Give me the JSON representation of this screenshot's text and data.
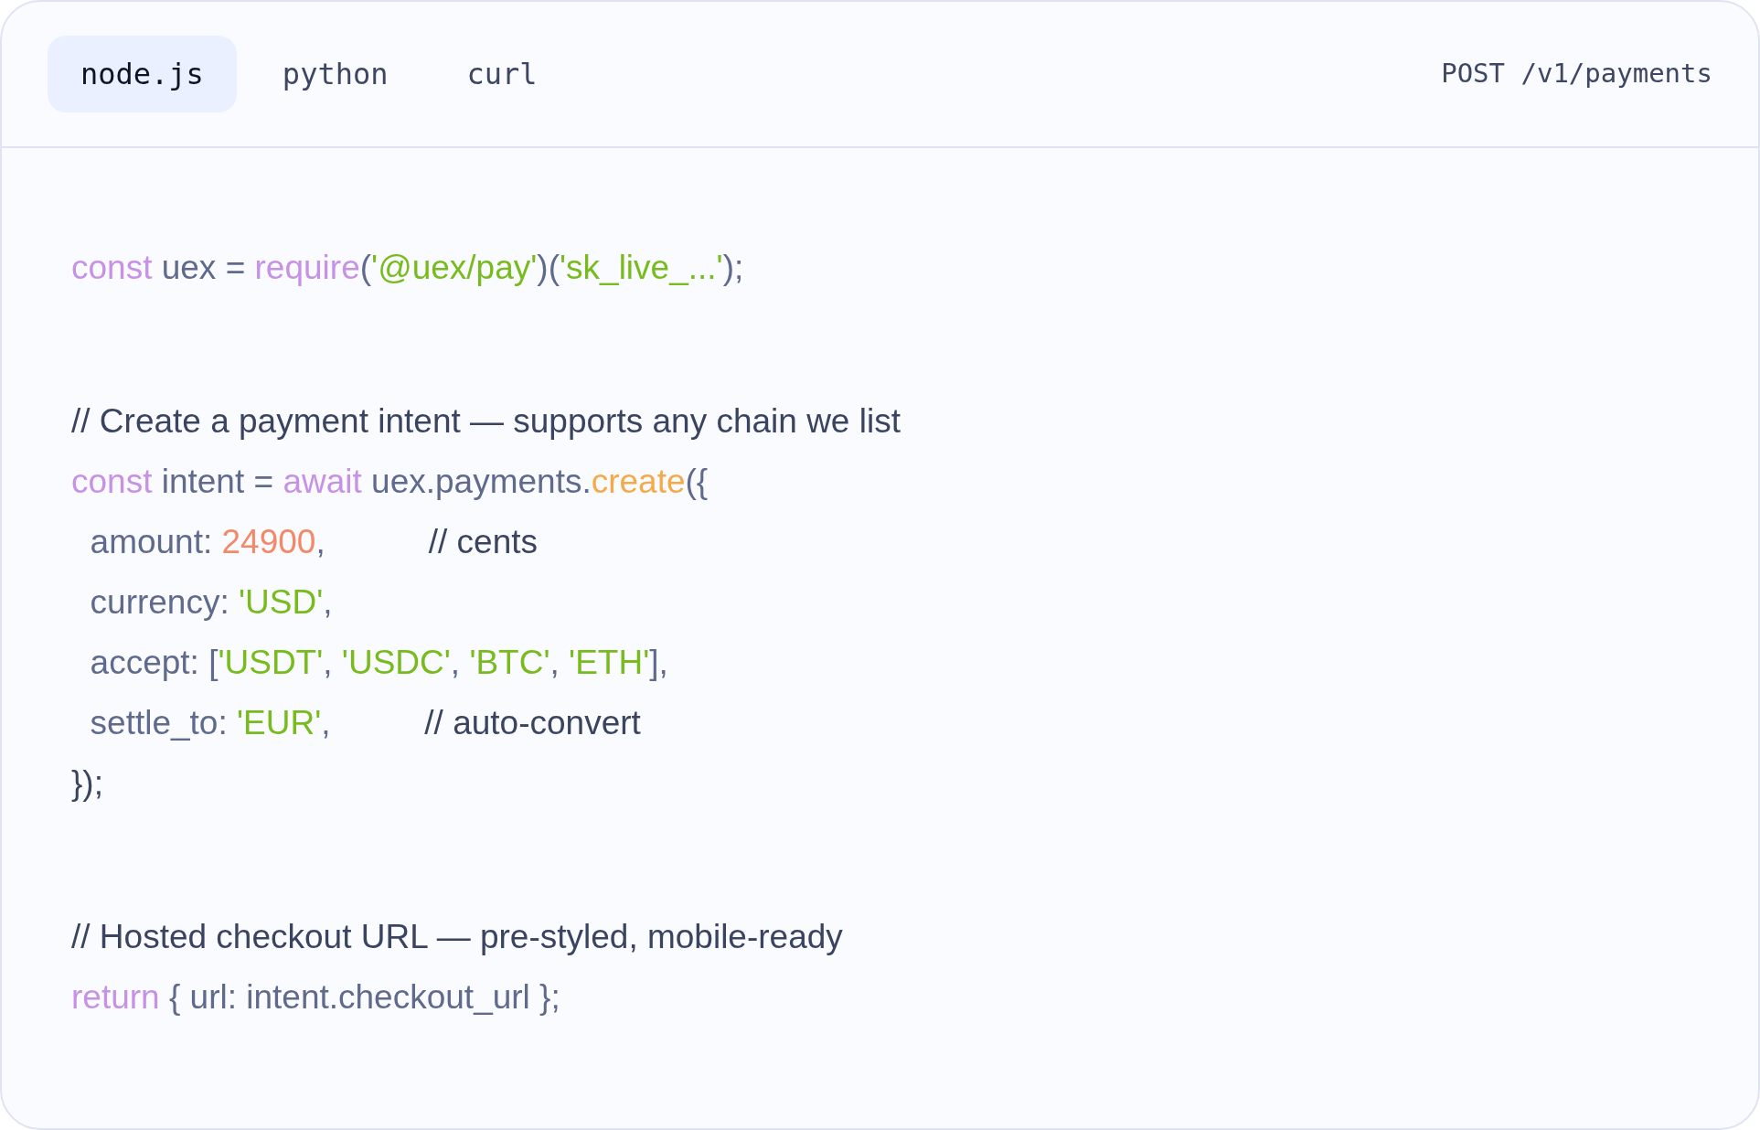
{
  "tabs": [
    {
      "label": "node.js",
      "selected": true
    },
    {
      "label": "python",
      "selected": false
    },
    {
      "label": "curl",
      "selected": false
    }
  ],
  "endpoint": "POST /v1/payments",
  "code_blocks": [
    [
      [
        {
          "kind": "keyword",
          "text": "const"
        },
        {
          "kind": "plain",
          "text": " uex = "
        },
        {
          "kind": "keyword",
          "text": "require"
        },
        {
          "kind": "plain",
          "text": "("
        },
        {
          "kind": "string",
          "text": "'@uex/pay'"
        },
        {
          "kind": "plain",
          "text": ")("
        },
        {
          "kind": "string",
          "text": "'sk_live_...'"
        },
        {
          "kind": "plain",
          "text": ");"
        }
      ]
    ],
    [
      [
        {
          "kind": "comment",
          "text": "// Create a payment intent — supports any chain we list"
        }
      ],
      [
        {
          "kind": "keyword",
          "text": "const"
        },
        {
          "kind": "plain",
          "text": " intent = "
        },
        {
          "kind": "keyword",
          "text": "await"
        },
        {
          "kind": "plain",
          "text": " uex.payments."
        },
        {
          "kind": "function",
          "text": "create"
        },
        {
          "kind": "plain",
          "text": "({"
        }
      ],
      [
        {
          "kind": "plain",
          "text": "  amount: "
        },
        {
          "kind": "number",
          "text": "24900"
        },
        {
          "kind": "plain",
          "text": ",           "
        },
        {
          "kind": "comment",
          "text": "// cents"
        }
      ],
      [
        {
          "kind": "plain",
          "text": "  currency: "
        },
        {
          "kind": "string",
          "text": "'USD'"
        },
        {
          "kind": "plain",
          "text": ","
        }
      ],
      [
        {
          "kind": "plain",
          "text": "  accept: ["
        },
        {
          "kind": "string",
          "text": "'USDT'"
        },
        {
          "kind": "plain",
          "text": ", "
        },
        {
          "kind": "string",
          "text": "'USDC'"
        },
        {
          "kind": "plain",
          "text": ", "
        },
        {
          "kind": "string",
          "text": "'BTC'"
        },
        {
          "kind": "plain",
          "text": ", "
        },
        {
          "kind": "string",
          "text": "'ETH'"
        },
        {
          "kind": "plain",
          "text": "],"
        }
      ],
      [
        {
          "kind": "plain",
          "text": "  settle_to: "
        },
        {
          "kind": "string",
          "text": "'EUR'"
        },
        {
          "kind": "plain",
          "text": ",          "
        },
        {
          "kind": "comment",
          "text": "// auto-convert"
        }
      ],
      [
        {
          "kind": "comment",
          "text": "});"
        }
      ]
    ],
    [
      [
        {
          "kind": "comment",
          "text": "// Hosted checkout URL — pre-styled, mobile-ready"
        }
      ],
      [
        {
          "kind": "keyword",
          "text": "return"
        },
        {
          "kind": "plain",
          "text": " { url: intent.checkout_url };"
        }
      ]
    ]
  ]
}
